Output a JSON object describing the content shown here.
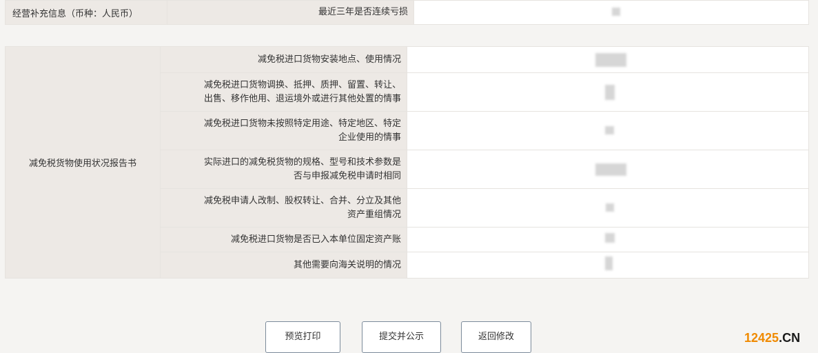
{
  "supplementary": {
    "section_label": "经营补充信息（币种：人民币）",
    "row_label": "最近三年是否连续亏损"
  },
  "report": {
    "section_label": "减免税货物使用状况报告书",
    "rows": [
      {
        "label_lines": [
          "减免税进口货物安装地点、使用情况"
        ]
      },
      {
        "label_lines": [
          "减免税进口货物调换、抵押、质押、留置、转让、",
          "出售、移作他用、退运境外或进行其他处置的情事"
        ]
      },
      {
        "label_lines": [
          "减免税进口货物未按照特定用途、特定地区、特定",
          "企业使用的情事"
        ]
      },
      {
        "label_lines": [
          "实际进口的减免税货物的规格、型号和技术参数是",
          "否与申报减免税申请时相同"
        ]
      },
      {
        "label_lines": [
          "减免税申请人改制、股权转让、合并、分立及其他",
          "资产重组情况"
        ]
      },
      {
        "label_lines": [
          "减免税进口货物是否已入本单位固定资产账"
        ]
      },
      {
        "label_lines": [
          "其他需要向海关说明的情况"
        ]
      }
    ]
  },
  "buttons": {
    "preview_print": "预览打印",
    "submit_publish": "提交并公示",
    "return_edit": "返回修改"
  },
  "brand": {
    "main": "12425",
    "suffix": ".CN"
  }
}
